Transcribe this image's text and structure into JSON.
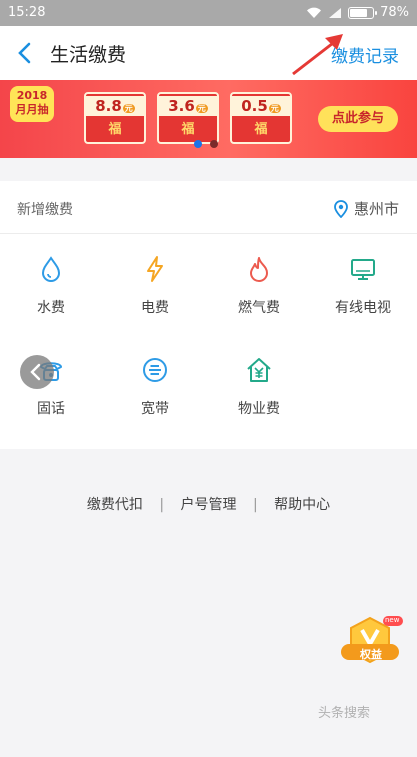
{
  "status": {
    "time": "15:28",
    "battery": "78%",
    "battery_level": 0.78
  },
  "header": {
    "title": "生活缴费",
    "records": "缴费记录"
  },
  "banner": {
    "badge_year": "2018",
    "badge_text": "月月抽",
    "envelopes": [
      {
        "amount": "8.8",
        "unit": "元",
        "fu": "福"
      },
      {
        "amount": "3.6",
        "unit": "元",
        "fu": "福"
      },
      {
        "amount": "0.5",
        "unit": "元",
        "fu": "福"
      }
    ],
    "cta": "点此参与"
  },
  "new_payment": {
    "title": "新增缴费",
    "city": "惠州市",
    "services": [
      {
        "label": "水费",
        "icon": "water-drop-icon",
        "color": "#2e9be6"
      },
      {
        "label": "电费",
        "icon": "lightning-icon",
        "color": "#f5a623"
      },
      {
        "label": "燃气费",
        "icon": "flame-icon",
        "color": "#ec5b4f"
      },
      {
        "label": "有线电视",
        "icon": "tv-icon",
        "color": "#23a98a"
      },
      {
        "label": "固话",
        "icon": "telephone-icon",
        "color": "#2e9be6"
      },
      {
        "label": "宽带",
        "icon": "broadband-icon",
        "color": "#2e9be6"
      },
      {
        "label": "物业费",
        "icon": "house-yen-icon",
        "color": "#23a98a"
      }
    ]
  },
  "links": {
    "item1": "缴费代扣",
    "item2": "户号管理",
    "item3": "帮助中心",
    "sep": "|"
  },
  "widget": {
    "new_tag": "new",
    "label": "权益"
  },
  "watermark": "头条搜索"
}
